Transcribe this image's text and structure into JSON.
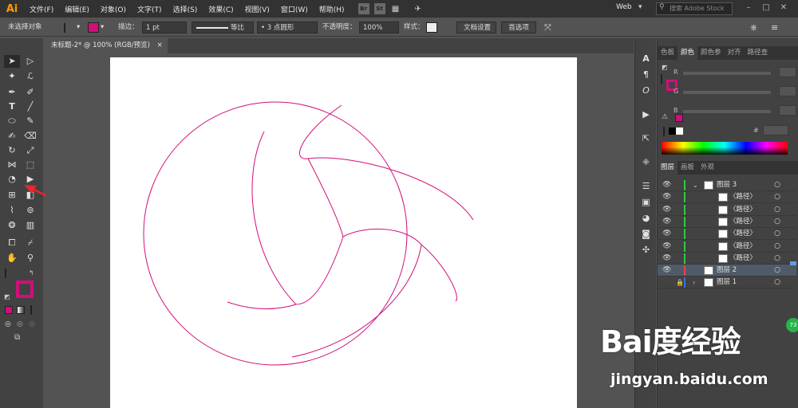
{
  "app": {
    "logo": "Ai",
    "workspace": "Web",
    "search_placeholder": "搜索 Adobe Stock"
  },
  "menu": [
    "文件(F)",
    "编辑(E)",
    "对象(O)",
    "文字(T)",
    "选择(S)",
    "效果(C)",
    "视图(V)",
    "窗口(W)",
    "帮助(H)"
  ],
  "menubar_badges": [
    "Br",
    "St"
  ],
  "control_bar": {
    "selection_status": "未选择对象",
    "stroke_label": "描边：",
    "stroke_weight": "1 pt",
    "profile_label": "等比",
    "brush_label": "3 点圆形",
    "opacity_label": "不透明度：",
    "opacity_value": "100%",
    "style_label": "样式：",
    "doc_setup_btn": "文档设置",
    "prefs_btn": "首选项"
  },
  "document_tab": {
    "title": "未标题-2* @ 100% (RGB/预览)",
    "close": "×"
  },
  "color_panel": {
    "tabs": [
      "色板",
      "颜色",
      "颜色参",
      "对齐",
      "路径查"
    ],
    "selected_tab": "颜色",
    "channels": [
      "R",
      "G",
      "B"
    ],
    "hex_label": "#"
  },
  "layers_panel": {
    "tabs": [
      "图层",
      "画板",
      "外观"
    ],
    "selected_tab": "图层",
    "rows": [
      {
        "name": "图层 3",
        "indent": 0
      },
      {
        "name": "〈路径〉",
        "indent": 1
      },
      {
        "name": "〈路径〉",
        "indent": 1
      },
      {
        "name": "〈路径〉",
        "indent": 1
      },
      {
        "name": "〈路径〉",
        "indent": 1
      },
      {
        "name": "〈路径〉",
        "indent": 1
      },
      {
        "name": "〈路径〉",
        "indent": 1
      },
      {
        "name": "图层 2",
        "indent": 0
      },
      {
        "name": "图层 1",
        "indent": 0
      }
    ]
  },
  "colors": {
    "stroke_magenta": "#d10f7a",
    "layer3_green": "#2ecc40",
    "layer2_red": "#e8434c",
    "layer1_blue": "#3d6fe0",
    "ui_dark": "#323232",
    "ui_panel": "#424242"
  },
  "watermark": {
    "logo": "Bai度经验",
    "url": "jingyan.baidu.com",
    "badge": "73"
  }
}
